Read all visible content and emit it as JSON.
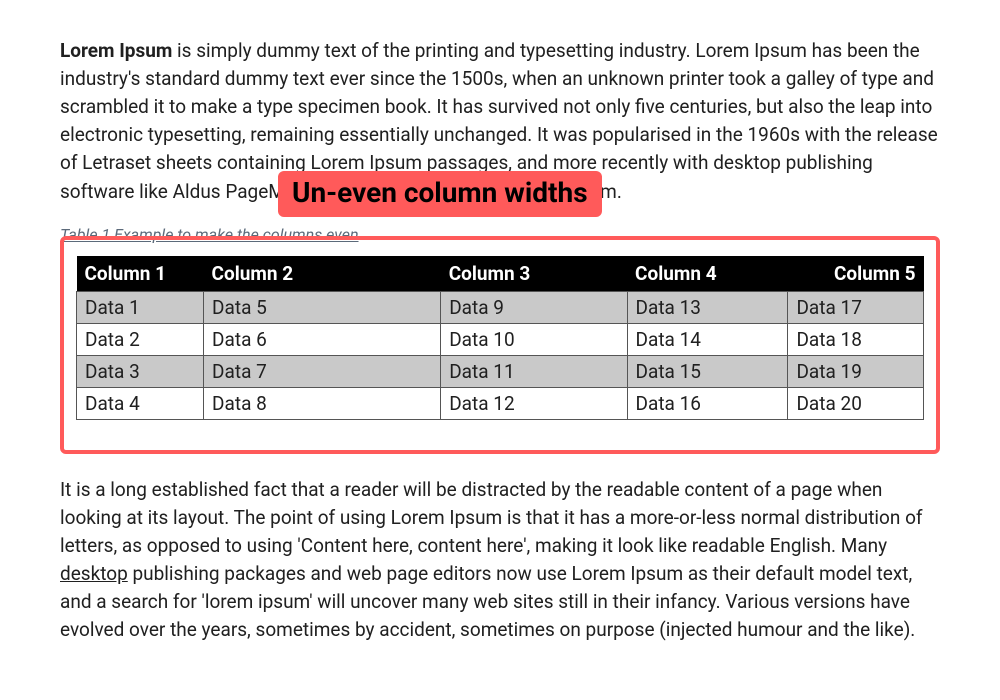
{
  "paragraph1": {
    "lead": "Lorem Ipsum",
    "rest": " is simply dummy text of the printing and typesetting industry. Lorem Ipsum has been the industry's standard dummy text ever since the 1500s, when an unknown printer took a galley of type and scrambled it to make a type specimen book. It has survived not only five centuries, but also the leap into electronic typesetting, remaining essentially unchanged. It was popularised in the 1960s with the release of Letraset sheets containing Lorem Ipsum passages, and more recently with desktop publishing software like Aldus PageMaker including versions of Lorem Ipsum."
  },
  "callout": "Un-even column widths",
  "caption": "Table 1 Example to make the columns even",
  "table": {
    "headers": [
      "Column 1",
      "Column 2",
      "Column 3",
      "Column 4",
      "Column 5"
    ],
    "rows": [
      [
        "Data 1",
        "Data 5",
        "Data 9",
        "Data 13",
        "Data 17"
      ],
      [
        "Data 2",
        "Data 6",
        "Data 10",
        "Data 14",
        "Data 18"
      ],
      [
        "Data 3",
        "Data 7",
        "Data 11",
        "Data 15",
        "Data 19"
      ],
      [
        "Data 4",
        "Data 8",
        "Data 12",
        "Data 16",
        "Data 20"
      ]
    ]
  },
  "paragraph2": {
    "before": "It is a long established fact that a reader will be distracted by the readable content of a page when looking at its layout. The point of using Lorem Ipsum is that it has a more-or-less normal distribution of letters, as opposed to using 'Content here, content here', making it look like readable English. Many ",
    "link": "desktop",
    "after": " publishing packages and web page editors now use Lorem Ipsum as their default model text, and a search for 'lorem ipsum' will uncover many web sites still in their infancy. Various versions have evolved over the years, sometimes by accident, sometimes on purpose (injected humour and the like)."
  }
}
